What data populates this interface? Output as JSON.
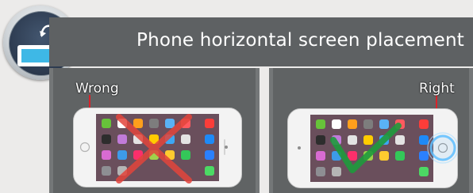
{
  "title": "Phone  horizontal screen placement",
  "wrong_label": "Wrong",
  "right_label": "Right",
  "colors": {
    "banner": "#5e6163",
    "panel": "#606364",
    "background": "#ecebea",
    "cross": "#e2453c",
    "check": "#1e9a3c",
    "highlight": "#5fbfff",
    "pointer": "#d8232a"
  },
  "icons": [
    "phone-rotate-icon",
    "cross-icon",
    "check-icon"
  ]
}
